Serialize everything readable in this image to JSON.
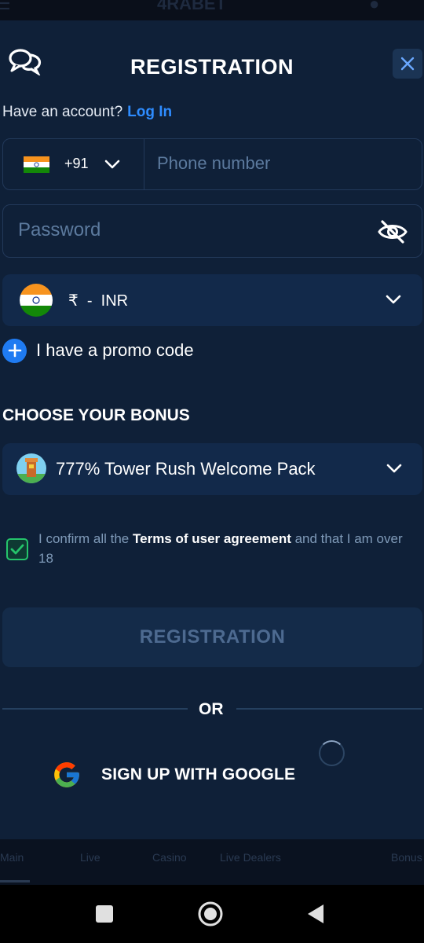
{
  "header": {
    "title": "REGISTRATION",
    "close_icon": "close-icon",
    "support_icon": "chat-bubbles-icon"
  },
  "login_prompt": {
    "text": "Have an account?",
    "link": "Log In"
  },
  "phone": {
    "country_code": "+91",
    "flag": "india-flag-icon",
    "placeholder": "Phone number"
  },
  "password": {
    "placeholder": "Password",
    "toggle_icon": "eye-off-icon"
  },
  "currency": {
    "symbol": "₹",
    "separator": "-",
    "code": "INR",
    "flag": "india-flag-icon"
  },
  "promo": {
    "label": "I have a promo code"
  },
  "bonus": {
    "heading": "CHOOSE YOUR BONUS",
    "selected": "777% Tower Rush Welcome Pack"
  },
  "agreement": {
    "prefix": "I confirm all the ",
    "terms_link": "Terms of user agreement",
    "suffix": " and that I am over 18",
    "checked": true
  },
  "register_button": "REGISTRATION",
  "divider": "OR",
  "google": {
    "label": "SIGN UP WITH GOOGLE"
  },
  "bottom_nav": [
    "Main",
    "Live",
    "Casino",
    "Live Dealers",
    "",
    "Bonus"
  ],
  "colors": {
    "accent": "#2e8cff",
    "background": "#0f2038",
    "check_green": "#25c46b"
  }
}
